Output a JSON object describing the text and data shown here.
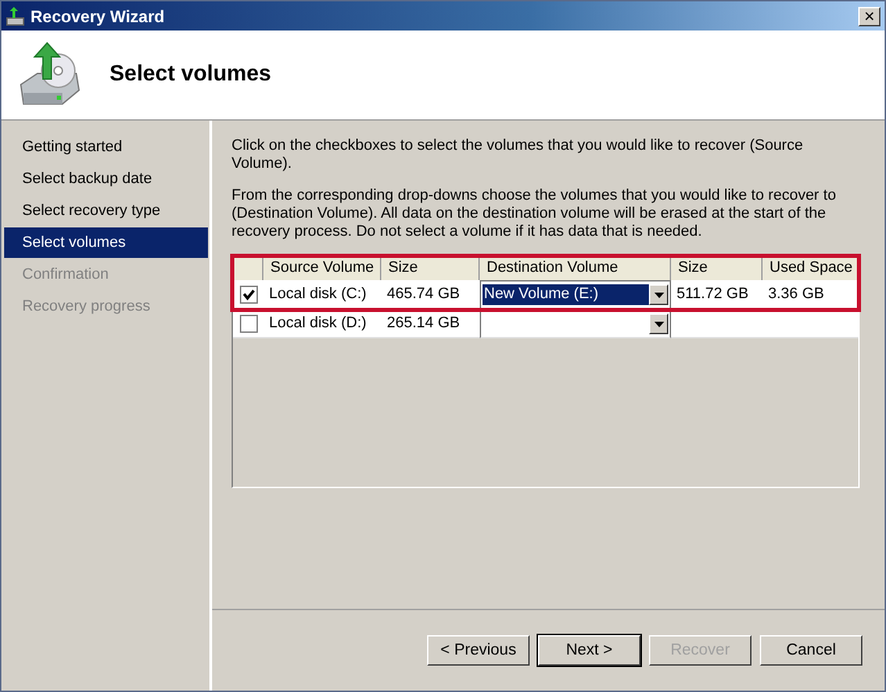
{
  "window": {
    "title": "Recovery Wizard",
    "close": "×"
  },
  "header": {
    "title": "Select volumes"
  },
  "sidebar": {
    "items": [
      {
        "label": "Getting started",
        "selected": false,
        "disabled": false
      },
      {
        "label": "Select backup date",
        "selected": false,
        "disabled": false
      },
      {
        "label": "Select recovery type",
        "selected": false,
        "disabled": false
      },
      {
        "label": "Select volumes",
        "selected": true,
        "disabled": false
      },
      {
        "label": "Confirmation",
        "selected": false,
        "disabled": true
      },
      {
        "label": "Recovery progress",
        "selected": false,
        "disabled": true
      }
    ]
  },
  "instructions": [
    "Click on the checkboxes to select the volumes that you would like to recover (Source Volume).",
    "From the corresponding drop-downs choose the volumes that you would like to recover to (Destination Volume). All data on the destination volume will be erased at the start of the recovery process. Do not select a volume if it has data that is needed."
  ],
  "table": {
    "columns": [
      "Source Volume",
      "Size",
      "Destination Volume",
      "Size",
      "Used Space"
    ],
    "rows": [
      {
        "checked": true,
        "highlighted": true,
        "source": "Local disk (C:)",
        "size": "465.74 GB",
        "destination": "New Volume (E:)",
        "destination_selected": true,
        "dest_size": "511.72 GB",
        "used_space": "3.36 GB"
      },
      {
        "checked": false,
        "highlighted": false,
        "source": "Local disk (D:)",
        "size": "265.14 GB",
        "destination_selected": false
      }
    ]
  },
  "buttons": [
    {
      "label": "< Previous",
      "default": false,
      "disabled": false
    },
    {
      "label": "Next >",
      "default": true,
      "disabled": false
    },
    {
      "label": "Recover",
      "default": false,
      "disabled": true
    },
    {
      "label": "Cancel",
      "default": false,
      "disabled": false
    }
  ]
}
